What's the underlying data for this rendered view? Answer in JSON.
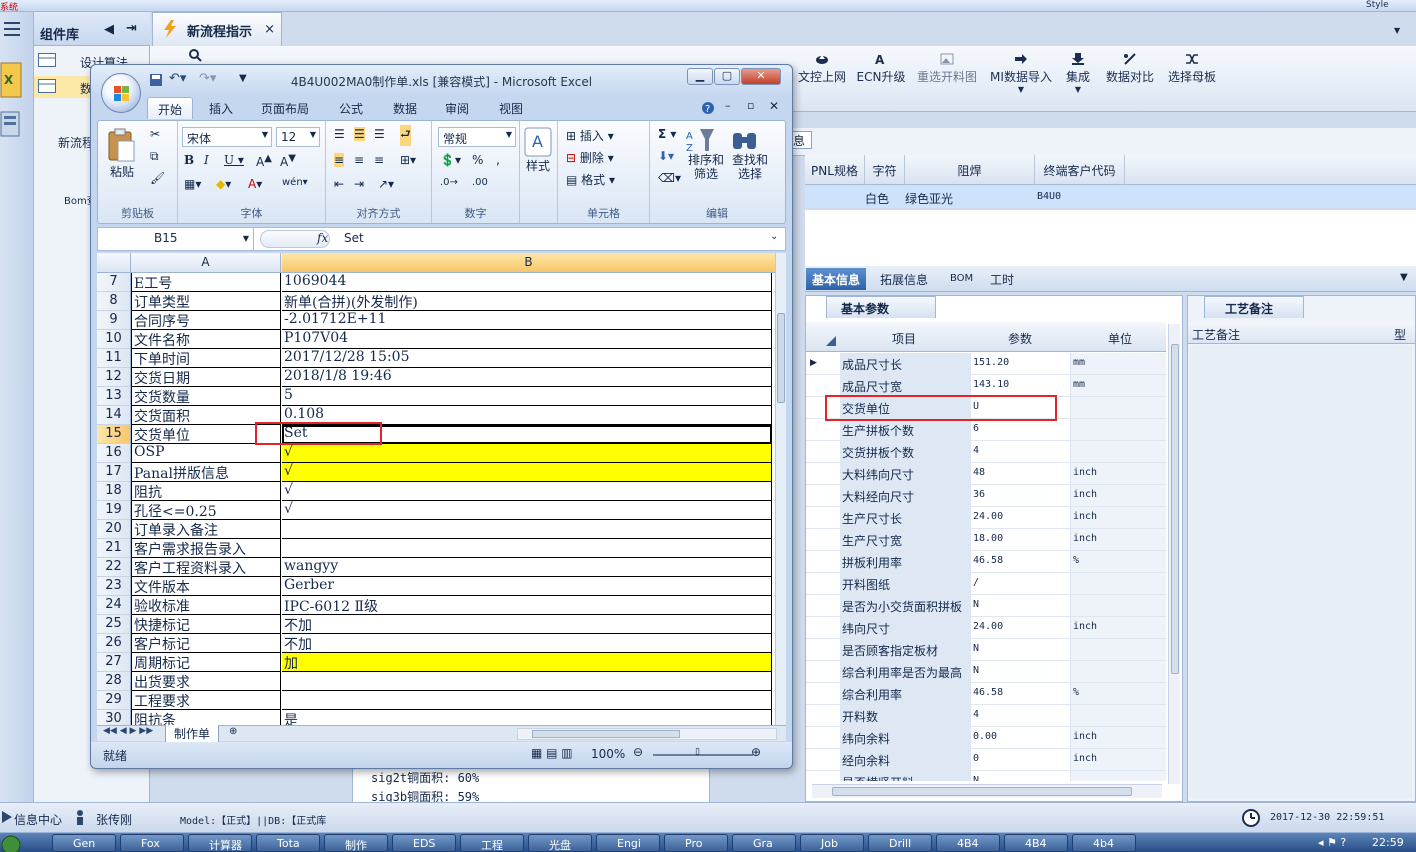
{
  "host": {
    "top_strip_left": "系统",
    "top_strip_right": "Style",
    "library_title": "组件库",
    "library_items": [
      "设计算法",
      "数"
    ],
    "left_labels": [
      "新流程",
      "Bom查"
    ],
    "doc_tab": "新流程指示",
    "toolbar": [
      {
        "label": "文控上网",
        "icon": "cloud-upload-icon"
      },
      {
        "label": "ECN升级",
        "icon": "ecn-icon"
      },
      {
        "label": "重选开料图",
        "icon": "image-icon"
      },
      {
        "label": "MI数据导入",
        "icon": "import-icon"
      },
      {
        "label": "集成",
        "icon": "download-icon"
      },
      {
        "label": "数据对比",
        "icon": "compare-icon"
      },
      {
        "label": "选择母板",
        "icon": "shuffle-icon"
      }
    ],
    "grid_label_fragment": "息",
    "grid_headers": [
      "PNL规格",
      "字符",
      "阻焊",
      "终端客户代码"
    ],
    "grid_row": {
      "char": "白色",
      "mask": "绿色亚光",
      "customer_code": "B4U0"
    },
    "tabs": [
      "基本信息",
      "拓展信息",
      "BOM",
      "工时"
    ],
    "params_panel_title": "基本参数",
    "params_headers": [
      "项目",
      "参数",
      "单位"
    ],
    "params": [
      [
        "成品尺寸长",
        "151.20",
        "mm"
      ],
      [
        "成品尺寸宽",
        "143.10",
        "mm"
      ],
      [
        "交货单位",
        "U",
        ""
      ],
      [
        "生产拼板个数",
        "6",
        ""
      ],
      [
        "交货拼板个数",
        "4",
        ""
      ],
      [
        "大料纬向尺寸",
        "48",
        "inch"
      ],
      [
        "大料经向尺寸",
        "36",
        "inch"
      ],
      [
        "生产尺寸长",
        "24.00",
        "inch"
      ],
      [
        "生产尺寸宽",
        "18.00",
        "inch"
      ],
      [
        "拼板利用率",
        "46.58",
        "%"
      ],
      [
        "开料图纸",
        "/",
        ""
      ],
      [
        "是否为小交货面积拼板",
        "N",
        ""
      ],
      [
        "纬向尺寸",
        "24.00",
        "inch"
      ],
      [
        "是否顾客指定板材",
        "N",
        ""
      ],
      [
        "综合利用率是否为最高",
        "N",
        ""
      ],
      [
        "综合利用率",
        "46.58",
        "%"
      ],
      [
        "开料数",
        "4",
        ""
      ],
      [
        "纬向余料",
        "0.00",
        "inch"
      ],
      [
        "经向余料",
        "0",
        "inch"
      ],
      [
        "是否横竖开料",
        "N",
        ""
      ]
    ],
    "remarks_tab": "工艺备注",
    "remarks_header": "工艺备注",
    "remarks_header2": "型",
    "sig_lines": [
      "sig2t铜面积: 60%",
      "sig3b铜面积: 59%"
    ],
    "sig_zoom": "100%",
    "status": {
      "info_center": "信息中心",
      "user": "张传刚",
      "model": "Model:【正式】||DB:【正式库",
      "datetime": "2017-12-30 22:59:51"
    },
    "taskbar": [
      "Gen",
      "Fox",
      "计算器",
      "Tota",
      "制作",
      "EDS",
      "工程",
      "光盘",
      "Engi",
      "Pro",
      "Gra",
      "Job",
      "Drill",
      "4B4",
      "4B4",
      "4b4"
    ],
    "clock": "22:59"
  },
  "excel": {
    "title": "4B4U002MA0制作单.xls  [兼容模式] - Microsoft Excel",
    "tabs": [
      "开始",
      "插入",
      "页面布局",
      "公式",
      "数据",
      "审阅",
      "视图"
    ],
    "ribbon": {
      "paste": "粘贴",
      "clipboard": "剪贴板",
      "font_name": "宋体",
      "font_size": "12",
      "font_group": "字体",
      "align_group": "对齐方式",
      "number_format": "常规",
      "number_group": "数字",
      "styles": "样式",
      "insert": "插入",
      "delete": "删除",
      "format": "格式",
      "cells_group": "单元格",
      "sort": "排序和\n筛选",
      "find": "查找和\n选择",
      "edit_group": "编辑"
    },
    "name_box": "B15",
    "formula": "Set",
    "col_a": "A",
    "col_b": "B",
    "rows": [
      {
        "n": "7",
        "a": "E工号",
        "b": "1069044",
        "hl": false
      },
      {
        "n": "8",
        "a": "订单类型",
        "b": "新单(合拼)(外发制作)",
        "hl": false
      },
      {
        "n": "9",
        "a": "合同序号",
        "b": "-2.01712E+11",
        "hl": false
      },
      {
        "n": "10",
        "a": "文件名称",
        "b": "P107V04",
        "hl": false
      },
      {
        "n": "11",
        "a": "下单时间",
        "b": "2017/12/28 15:05",
        "hl": false
      },
      {
        "n": "12",
        "a": "交货日期",
        "b": "2018/1/8 19:46",
        "hl": false
      },
      {
        "n": "13",
        "a": "交货数量",
        "b": "5",
        "hl": false
      },
      {
        "n": "14",
        "a": "交货面积",
        "b": "0.108",
        "hl": false
      },
      {
        "n": "15",
        "a": "交货单位",
        "b": "Set",
        "hl": false
      },
      {
        "n": "16",
        "a": "OSP",
        "b": "√",
        "hl": true
      },
      {
        "n": "17",
        "a": "Panal拼版信息",
        "b": "√",
        "hl": true
      },
      {
        "n": "18",
        "a": "阻抗",
        "b": "√",
        "hl": false
      },
      {
        "n": "19",
        "a": "孔径<=0.25",
        "b": "√",
        "hl": false
      },
      {
        "n": "20",
        "a": "订单录入备注",
        "b": "",
        "hl": false
      },
      {
        "n": "21",
        "a": "客户需求报告录入",
        "b": "",
        "hl": false
      },
      {
        "n": "22",
        "a": "客户工程资料录入",
        "b": "wangyy",
        "hl": false
      },
      {
        "n": "23",
        "a": "文件版本",
        "b": "Gerber",
        "hl": false
      },
      {
        "n": "24",
        "a": "验收标准",
        "b": "IPC-6012 Ⅱ级",
        "hl": false
      },
      {
        "n": "25",
        "a": "快捷标记",
        "b": "不加",
        "hl": false
      },
      {
        "n": "26",
        "a": "客户标记",
        "b": "不加",
        "hl": false
      },
      {
        "n": "27",
        "a": "周期标记",
        "b": "加",
        "hl": true
      },
      {
        "n": "28",
        "a": "出货要求",
        "b": "",
        "hl": false
      },
      {
        "n": "29",
        "a": "工程要求",
        "b": "",
        "hl": false
      },
      {
        "n": "30",
        "a": "阻抗条",
        "b": "是",
        "hl": false
      }
    ],
    "sheet_tab": "制作单",
    "status_ready": "就绪",
    "zoom": "100%"
  },
  "colors": {
    "highlight_yellow": "#ffff00",
    "callout_red": "#e0262b",
    "selected_row": "#cfe2fb"
  }
}
